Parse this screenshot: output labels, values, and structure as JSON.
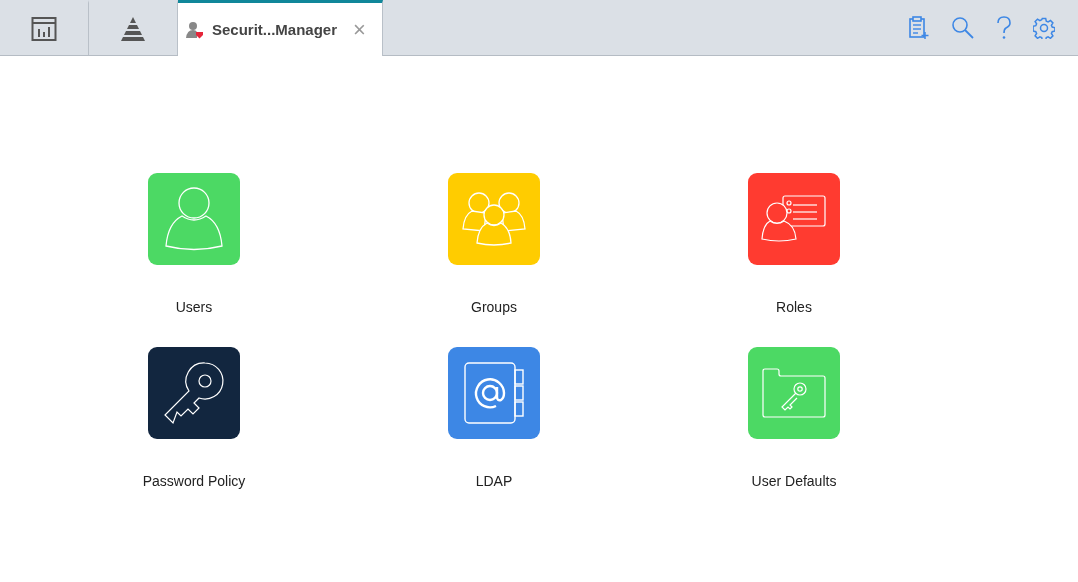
{
  "tabs": [
    {
      "kind": "dashboard",
      "selected": false
    },
    {
      "kind": "pyramid",
      "selected": false
    },
    {
      "kind": "security",
      "label": "Securit...Manager",
      "close": "×",
      "selected": true
    }
  ],
  "toolbar": [
    {
      "kind": "clipboard-add"
    },
    {
      "kind": "search"
    },
    {
      "kind": "help"
    },
    {
      "kind": "settings"
    }
  ],
  "tiles": [
    {
      "kind": "user",
      "label": "Users",
      "color": "#4cd964"
    },
    {
      "kind": "group",
      "label": "Groups",
      "color": "#ffcc00"
    },
    {
      "kind": "role",
      "label": "Roles",
      "color": "#ff3b30"
    },
    {
      "kind": "key",
      "label": "Password Policy",
      "color": "#12263f"
    },
    {
      "kind": "address-book",
      "label": "LDAP",
      "color": "#3d87e5"
    },
    {
      "kind": "folder-key",
      "label": "User Defaults",
      "color": "#4cd964"
    }
  ]
}
